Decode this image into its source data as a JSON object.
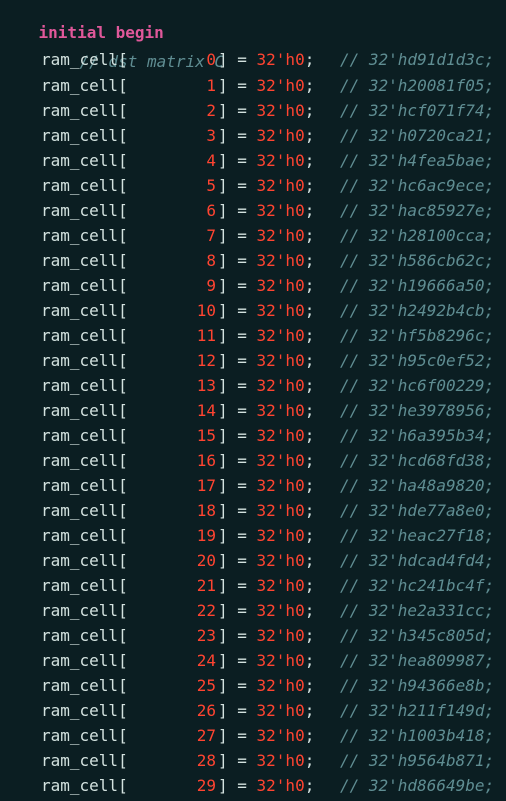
{
  "code": {
    "header_keyword": "initial begin",
    "section_comment": "// dst matrix C",
    "array_name": "ram_cell",
    "open_bracket": "[",
    "close_assign": "] = ",
    "assign_value": "32'h0",
    "terminator": ";",
    "rows": [
      {
        "index": "0",
        "comment": "// 32'hd91d1d3c;"
      },
      {
        "index": "1",
        "comment": "// 32'h20081f05;"
      },
      {
        "index": "2",
        "comment": "// 32'hcf071f74;"
      },
      {
        "index": "3",
        "comment": "// 32'h0720ca21;"
      },
      {
        "index": "4",
        "comment": "// 32'h4fea5bae;"
      },
      {
        "index": "5",
        "comment": "// 32'hc6ac9ece;"
      },
      {
        "index": "6",
        "comment": "// 32'hac85927e;"
      },
      {
        "index": "7",
        "comment": "// 32'h28100cca;"
      },
      {
        "index": "8",
        "comment": "// 32'h586cb62c;"
      },
      {
        "index": "9",
        "comment": "// 32'h19666a50;"
      },
      {
        "index": "10",
        "comment": "// 32'h2492b4cb;"
      },
      {
        "index": "11",
        "comment": "// 32'hf5b8296c;"
      },
      {
        "index": "12",
        "comment": "// 32'h95c0ef52;"
      },
      {
        "index": "13",
        "comment": "// 32'hc6f00229;"
      },
      {
        "index": "14",
        "comment": "// 32'he3978956;"
      },
      {
        "index": "15",
        "comment": "// 32'h6a395b34;"
      },
      {
        "index": "16",
        "comment": "// 32'hcd68fd38;"
      },
      {
        "index": "17",
        "comment": "// 32'ha48a9820;"
      },
      {
        "index": "18",
        "comment": "// 32'hde77a8e0;"
      },
      {
        "index": "19",
        "comment": "// 32'heac27f18;"
      },
      {
        "index": "20",
        "comment": "// 32'hdcad4fd4;"
      },
      {
        "index": "21",
        "comment": "// 32'hc241bc4f;"
      },
      {
        "index": "22",
        "comment": "// 32'he2a331cc;"
      },
      {
        "index": "23",
        "comment": "// 32'h345c805d;"
      },
      {
        "index": "24",
        "comment": "// 32'hea809987;"
      },
      {
        "index": "25",
        "comment": "// 32'h94366e8b;"
      },
      {
        "index": "26",
        "comment": "// 32'h211f149d;"
      },
      {
        "index": "27",
        "comment": "// 32'h1003b418;"
      },
      {
        "index": "28",
        "comment": "// 32'h9564b871;"
      },
      {
        "index": "29",
        "comment": "// 32'hd86649be;"
      }
    ]
  },
  "colors": {
    "background": "#0b1e22",
    "keyword": "#e0589a",
    "comment": "#5f8d92",
    "identifier": "#d3e2df",
    "number": "#ff4431"
  }
}
